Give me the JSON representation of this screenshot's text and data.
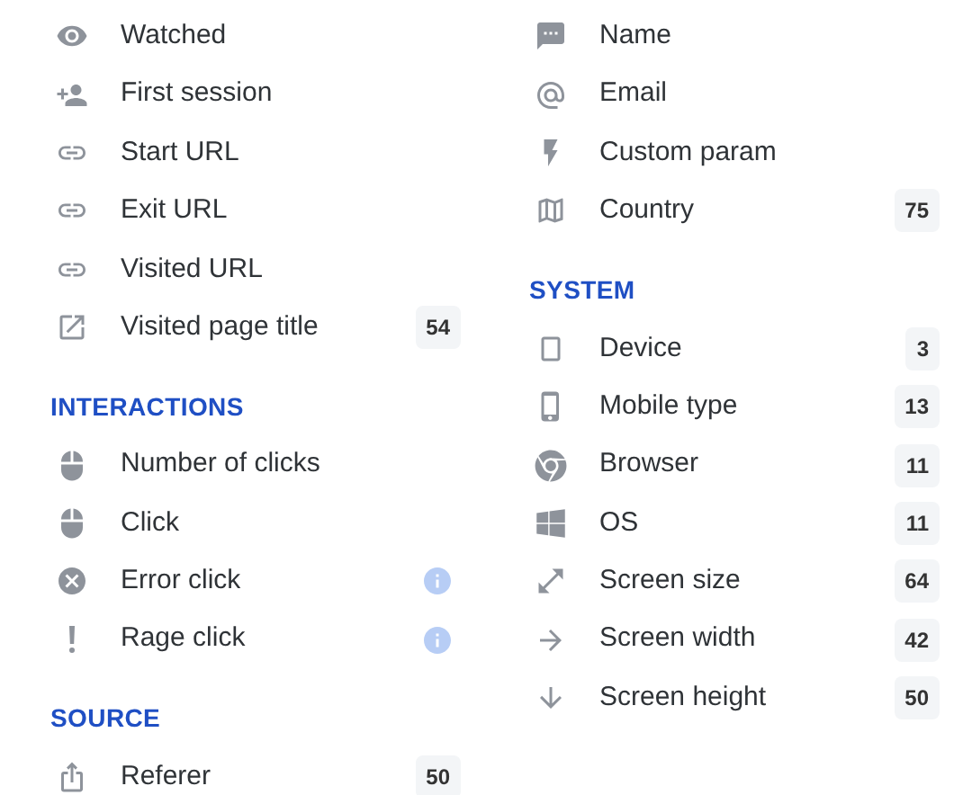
{
  "columns": [
    {
      "sections": [
        {
          "items": [
            {
              "label": "Watched"
            },
            {
              "label": "First session"
            },
            {
              "label": "Start URL"
            },
            {
              "label": "Exit URL"
            },
            {
              "label": "Visited URL"
            },
            {
              "label": "Visited page title",
              "badge": "54"
            }
          ]
        },
        {
          "heading": "INTERACTIONS",
          "items": [
            {
              "label": "Number of clicks"
            },
            {
              "label": "Click"
            },
            {
              "label": "Error click",
              "info": true
            },
            {
              "label": "Rage click",
              "info": true
            }
          ]
        },
        {
          "heading": "SOURCE",
          "items": [
            {
              "label": "Referer",
              "badge": "50"
            }
          ]
        }
      ]
    },
    {
      "sections": [
        {
          "items": [
            {
              "label": "Name"
            },
            {
              "label": "Email"
            },
            {
              "label": "Custom param"
            },
            {
              "label": "Country",
              "badge": "75"
            }
          ]
        },
        {
          "heading": "SYSTEM",
          "items": [
            {
              "label": "Device",
              "badge": "3"
            },
            {
              "label": "Mobile type",
              "badge": "13"
            },
            {
              "label": "Browser",
              "badge": "11"
            },
            {
              "label": "OS",
              "badge": "11"
            },
            {
              "label": "Screen size",
              "badge": "64"
            },
            {
              "label": "Screen width",
              "badge": "42"
            },
            {
              "label": "Screen height",
              "badge": "50"
            }
          ]
        }
      ]
    }
  ]
}
